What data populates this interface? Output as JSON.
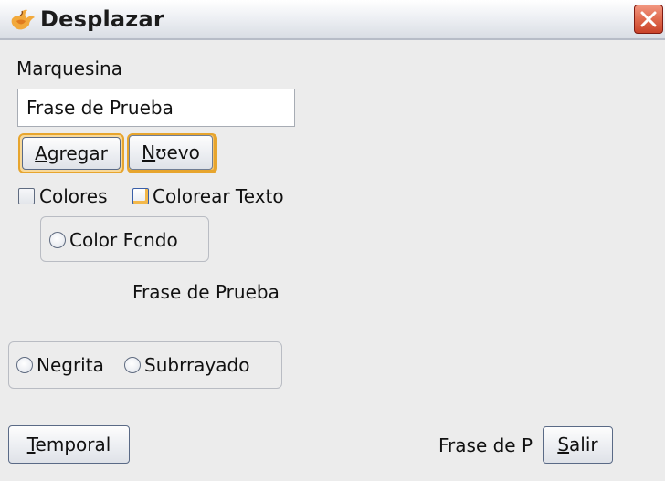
{
  "window": {
    "title": "Desplazar",
    "app_icon": "java-cup-icon",
    "close_icon": "close-icon"
  },
  "marquee": {
    "label": "Marquesina",
    "input_value": "Frase de Prueba"
  },
  "buttons": {
    "agregar": {
      "mnemonic": "A",
      "rest": "gregar"
    },
    "nuevo": {
      "mnemonic": "N",
      "rest": "ʊevo"
    },
    "temporal": {
      "mnemonic": "T",
      "rest": "emporal"
    },
    "salir": {
      "mnemonic": "S",
      "rest": "alir"
    }
  },
  "checkboxes": {
    "colores": {
      "label": "Colores",
      "checked": false
    },
    "colorear_texto": {
      "label": "Colorear Texto",
      "checked": false
    }
  },
  "radios": {
    "color_fondo": {
      "label": "Color Fcndo",
      "selected": false
    },
    "negrita": {
      "label": "Negrita",
      "selected": false
    },
    "subrrayado": {
      "label": "Subrrayado",
      "selected": false
    }
  },
  "preview": {
    "center_text": "Frase de Prueba",
    "marquee_text": "Frase de P"
  },
  "colors": {
    "focus_accent": "#e7a52e",
    "close_button": "#d9593d",
    "background": "#ececec"
  }
}
